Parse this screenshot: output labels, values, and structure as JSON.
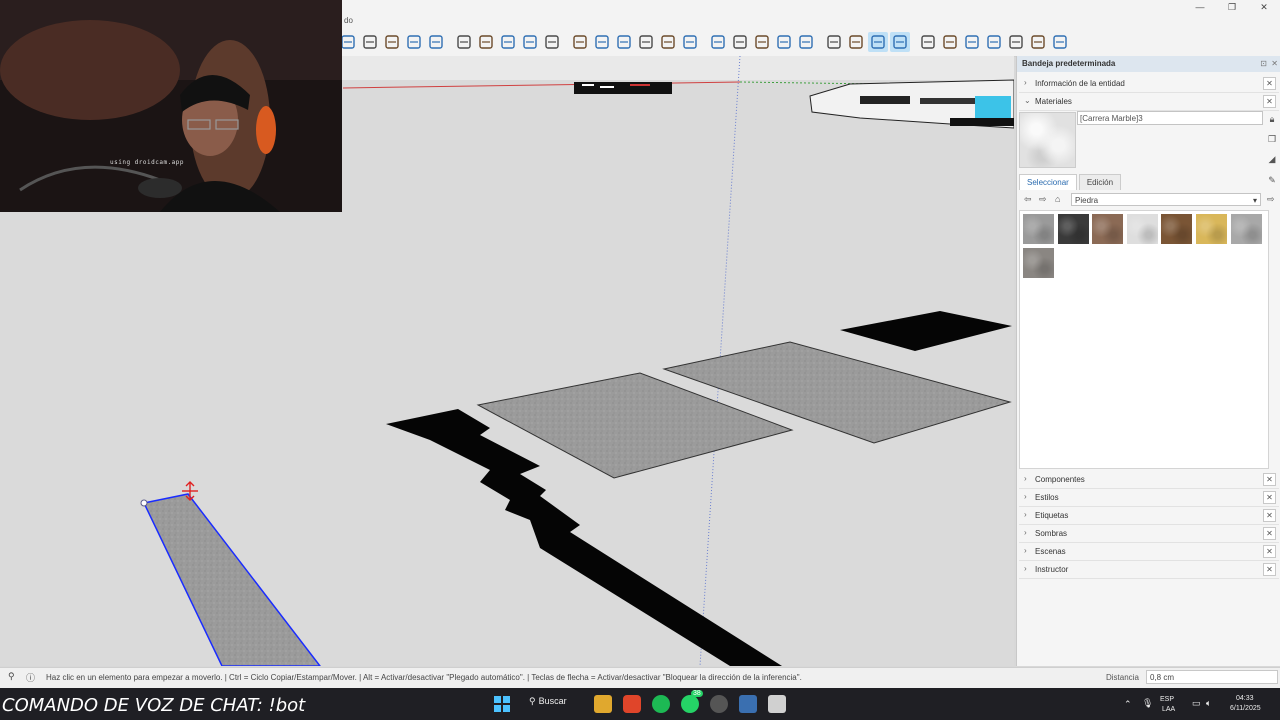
{
  "app": {
    "menu_fragment": "do",
    "window_controls": [
      "—",
      "❐",
      "✕"
    ]
  },
  "toolbar": {
    "icons": [
      "select-icon",
      "make-component-icon",
      "eraser-icon",
      "zoom-icon",
      "zoom-extents-icon",
      "section-plane-icon",
      "x-ray-icon",
      "back-edges-icon",
      "layers-icon",
      "account-icon",
      "iso-view-icon",
      "top-view-icon",
      "front-view-icon",
      "right-view-icon",
      "back-view-icon",
      "left-view-icon",
      "box-icon",
      "extrude-icon",
      "paint-icon",
      "layout-icon",
      "styles-icon",
      "orbit-icon",
      "pan-icon",
      "move-icon",
      "rotate-icon",
      "sandbox-icon",
      "push-icon",
      "follow-me-icon",
      "offset-icon",
      "tape-icon",
      "text-icon",
      "extension-icon"
    ],
    "active_indices": [
      23,
      24
    ]
  },
  "webcam": {
    "caption": "using droidcam.app"
  },
  "tray": {
    "title": "Bandeja predeterminada",
    "entity_info": "Información de la entidad",
    "materials": "Materiales",
    "material_name": "[Carrera Marble]3",
    "tabs": [
      "Seleccionar",
      "Edición"
    ],
    "library": "Piedra",
    "swatch_colors": [
      "#9a9a9a",
      "#3a3a3a",
      "#8b6a55",
      "#dedede",
      "#7a5535",
      "#d9b75a",
      "#a8a8a8",
      "#8a8682"
    ],
    "panels": [
      "Componentes",
      "Estilos",
      "Etiquetas",
      "Sombras",
      "Escenas",
      "Instructor"
    ]
  },
  "status": {
    "hint": "Haz clic en un elemento para empezar a moverlo. | Ctrl = Ciclo Copiar/Estampar/Mover. | Alt = Activar/desactivar \"Plegado automático\". | Teclas de flecha = Activar/desactivar \"Bloquear la dirección de la inferencia\".",
    "measure_label": "Distancia",
    "measure_value": "0,8 cm"
  },
  "taskbar": {
    "overlay": "COMANDO DE VOZ DE CHAT: !bot",
    "search_label": "Buscar",
    "lang_top": "ESP",
    "lang_bottom": "LAA",
    "time": "04:33",
    "date": "6/11/2025",
    "badge": "38"
  },
  "colors": {
    "accent": "#2b6cb0",
    "selection": "#1a2cff",
    "taskbar": "#1f1f24"
  }
}
